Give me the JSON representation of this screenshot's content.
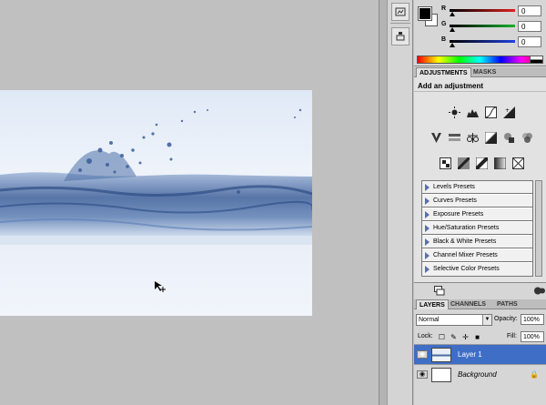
{
  "color_panel": {
    "channels": [
      {
        "label": "R",
        "value": "0",
        "color": "#e02020"
      },
      {
        "label": "G",
        "value": "0",
        "color": "#18b030"
      },
      {
        "label": "B",
        "value": "0",
        "color": "#2040e0"
      }
    ]
  },
  "adjust_tabs": [
    {
      "label": "ADJUSTMENTS"
    },
    {
      "label": "MASKS"
    }
  ],
  "adjustments": {
    "title": "Add an adjustment",
    "presets": [
      {
        "label": "Levels Presets"
      },
      {
        "label": "Curves Presets"
      },
      {
        "label": "Exposure Presets"
      },
      {
        "label": "Hue/Saturation Presets"
      },
      {
        "label": "Black & White Presets"
      },
      {
        "label": "Channel Mixer Presets"
      },
      {
        "label": "Selective Color Presets"
      }
    ]
  },
  "layer_tabs": [
    {
      "label": "LAYERS"
    },
    {
      "label": "CHANNELS"
    },
    {
      "label": "PATHS"
    }
  ],
  "layers_panel": {
    "blend_mode": "Normal",
    "opacity_label": "Opacity:",
    "opacity_value": "100%",
    "lock_label": "Lock:",
    "fill_label": "Fill:",
    "fill_value": "100%",
    "layers": [
      {
        "name": "Layer 1",
        "selected": true
      },
      {
        "name": "Background",
        "selected": false
      }
    ]
  },
  "colors": {
    "accent": "#3f6ec6",
    "panel": "#d6d6d6",
    "workspace": "#c0c0c0"
  }
}
